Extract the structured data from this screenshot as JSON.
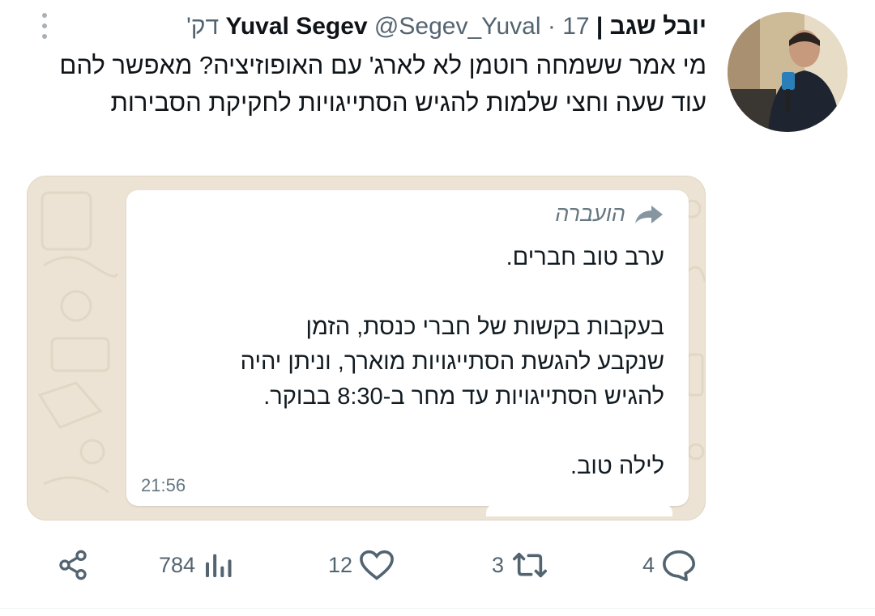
{
  "tweet": {
    "author_name": "Yuval Segev",
    "author_name_he": "יובל שגב",
    "separator": "|",
    "handle": "@Segev_Yuval",
    "dot": "·",
    "time": "17 דק'",
    "text": "מי אמר ששמחה רוטמן לא לארג' עם האופוזיציה? מאפשר להם עוד שעה וחצי שלמות להגיש הסתייגויות לחקיקת הסבירות"
  },
  "media": {
    "forwarded_label": "הועברה",
    "message_lines": [
      "ערב טוב חברים.",
      "",
      "בעקבות בקשות של חברי כנסת, הזמן",
      "שנקבע להגשת הסתייגויות מוארך, וניתן יהיה",
      "להגיש הסתייגויות עד מחר ב-8:30 בבוקר.",
      "",
      "לילה טוב."
    ],
    "timestamp": "21:56"
  },
  "actions": {
    "replies": "4",
    "retweets": "3",
    "likes": "12",
    "views": "784"
  },
  "colors": {
    "text_primary": "#0f1419",
    "text_secondary": "#536471",
    "whatsapp_bg": "#ece3d5"
  },
  "icons": [
    "more-icon",
    "forward-arrow-icon",
    "reply-icon",
    "retweet-icon",
    "like-icon",
    "views-icon",
    "share-icon"
  ]
}
